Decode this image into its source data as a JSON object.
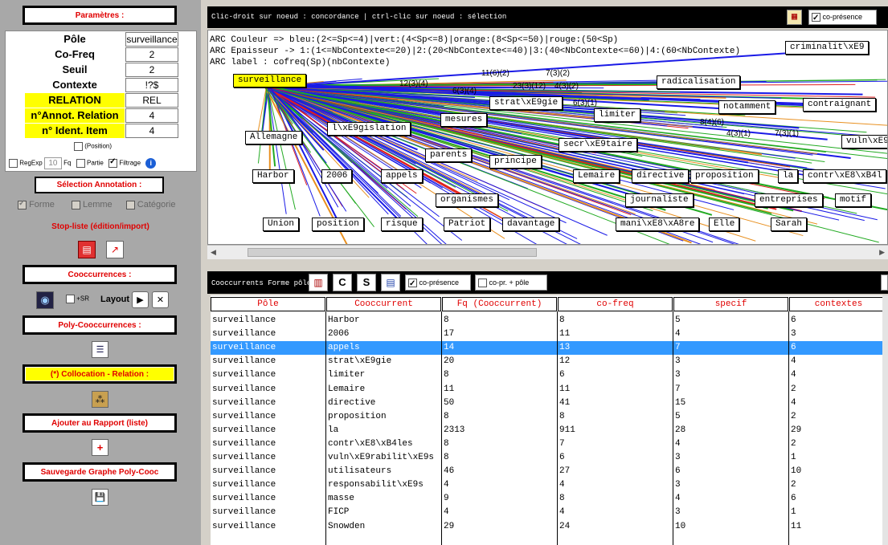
{
  "left": {
    "parametres_title": "Paramètres :",
    "params": [
      {
        "label": "Pôle",
        "value": "surveillance",
        "highlight": false
      },
      {
        "label": "Co-Freq",
        "value": "2",
        "highlight": false
      },
      {
        "label": "Seuil",
        "value": "2",
        "highlight": false
      },
      {
        "label": "Contexte",
        "value": "!?$",
        "highlight": false
      },
      {
        "label": "RELATION",
        "value": "REL",
        "highlight": true
      },
      {
        "label": "n°Annot. Relation",
        "value": "4",
        "highlight": true
      },
      {
        "label": "n° Ident. Item",
        "value": "4",
        "highlight": true
      }
    ],
    "position_label": "(Position)",
    "regexp_label": "RegExp",
    "fq_value": "10",
    "fq_label": "Fq",
    "partie_label": "Partie",
    "filtrage_label": "Filtrage",
    "selection_title": "Sélection Annotation :",
    "forme_label": "Forme",
    "lemme_label": "Lemme",
    "categorie_label": "Catégorie",
    "stop_liste_label": "Stop-liste (édition/import)",
    "cooccurrences_title": "Cooccurrences :",
    "sr_label": "+SR",
    "layout_label": "Layout",
    "poly_title": "Poly-Cooccurrences :",
    "collocation_title": "(*) Collocation - Relation :",
    "rapport_title": "Ajouter au Rapport (liste)",
    "sauvegarde_title": "Sauvegarde Graphe Poly-Cooc"
  },
  "graph": {
    "header_text": "Clic-droit sur noeud : concordance | ctrl-clic sur noeud : sélection",
    "copresence_label": "co-présence",
    "arc_lines": [
      "ARC Couleur => bleu:(2<=Sp<=4)|vert:(4<Sp<=8)|orange:(8<Sp<=50)|rouge:(50<Sp)",
      "ARC Epaisseur -> 1:(1<=NbContexte<=20)|2:(20<NbContexte<=40)|3:(40<NbContexte<=60)|4:(60<NbContexte)",
      "ARC label : cofreq(Sp)(nbContexte)"
    ],
    "pole": "surveillance",
    "nodes": [
      "criminalit\\xE9",
      "radicalisation",
      "strat\\xE9gie",
      "notamment",
      "contraignant",
      "limiter",
      "mesures",
      "l\\xE9gislation",
      "Allemagne",
      "secr\\xE9taire",
      "vuln\\xE9",
      "parents",
      "principe",
      "Harbor",
      "2006",
      "appels",
      "Lemaire",
      "directive",
      "proposition",
      "la",
      "contr\\xE8\\xB4l",
      "organismes",
      "journaliste",
      "entreprises",
      "motif",
      "Union",
      "position",
      "risque",
      "Patriot",
      "davantage",
      "mani\\xE8\\xA8re",
      "Elle",
      "Sarah"
    ],
    "edge_labels": [
      "11(6)(2)",
      "7(3)(2)",
      "12(3)(4)",
      "23(3)(12)",
      "4(3)(2)",
      "6(3)(4)",
      "6(3)(1)",
      "8(4)(6)",
      "4(3)(1)",
      "7(3)(1)"
    ]
  },
  "cooc": {
    "header_text": "Cooccurrents Forme pôle",
    "copresence_label": "co-présence",
    "copr_pole_label": "co-pr. + pôle",
    "columns": [
      "Pôle",
      "Cooccurrent",
      "Fq (Cooccurrent)",
      "co-freq",
      "specif",
      "contextes"
    ],
    "rows": [
      [
        "surveillance",
        "Harbor",
        "8",
        "8",
        "5",
        "6"
      ],
      [
        "surveillance",
        "2006",
        "17",
        "11",
        "4",
        "3"
      ],
      [
        "surveillance",
        "appels",
        "14",
        "13",
        "7",
        "6"
      ],
      [
        "surveillance",
        "strat\\xE9gie",
        "20",
        "12",
        "3",
        "4"
      ],
      [
        "surveillance",
        "limiter",
        "8",
        "6",
        "3",
        "4"
      ],
      [
        "surveillance",
        "Lemaire",
        "11",
        "11",
        "7",
        "2"
      ],
      [
        "surveillance",
        "directive",
        "50",
        "41",
        "15",
        "4"
      ],
      [
        "surveillance",
        "proposition",
        "8",
        "8",
        "5",
        "2"
      ],
      [
        "surveillance",
        "la",
        "2313",
        "911",
        "28",
        "29"
      ],
      [
        "surveillance",
        "contr\\xE8\\xB4les",
        "8",
        "7",
        "4",
        "2"
      ],
      [
        "surveillance",
        "vuln\\xE9rabilit\\xE9s",
        "8",
        "6",
        "3",
        "1"
      ],
      [
        "surveillance",
        "utilisateurs",
        "46",
        "27",
        "6",
        "10"
      ],
      [
        "surveillance",
        "responsabilit\\xE9s",
        "4",
        "4",
        "3",
        "2"
      ],
      [
        "surveillance",
        "masse",
        "9",
        "8",
        "4",
        "6"
      ],
      [
        "surveillance",
        "FICP",
        "4",
        "4",
        "3",
        "1"
      ],
      [
        "surveillance",
        "Snowden",
        "29",
        "24",
        "10",
        "11"
      ]
    ],
    "selected_row": 2
  }
}
